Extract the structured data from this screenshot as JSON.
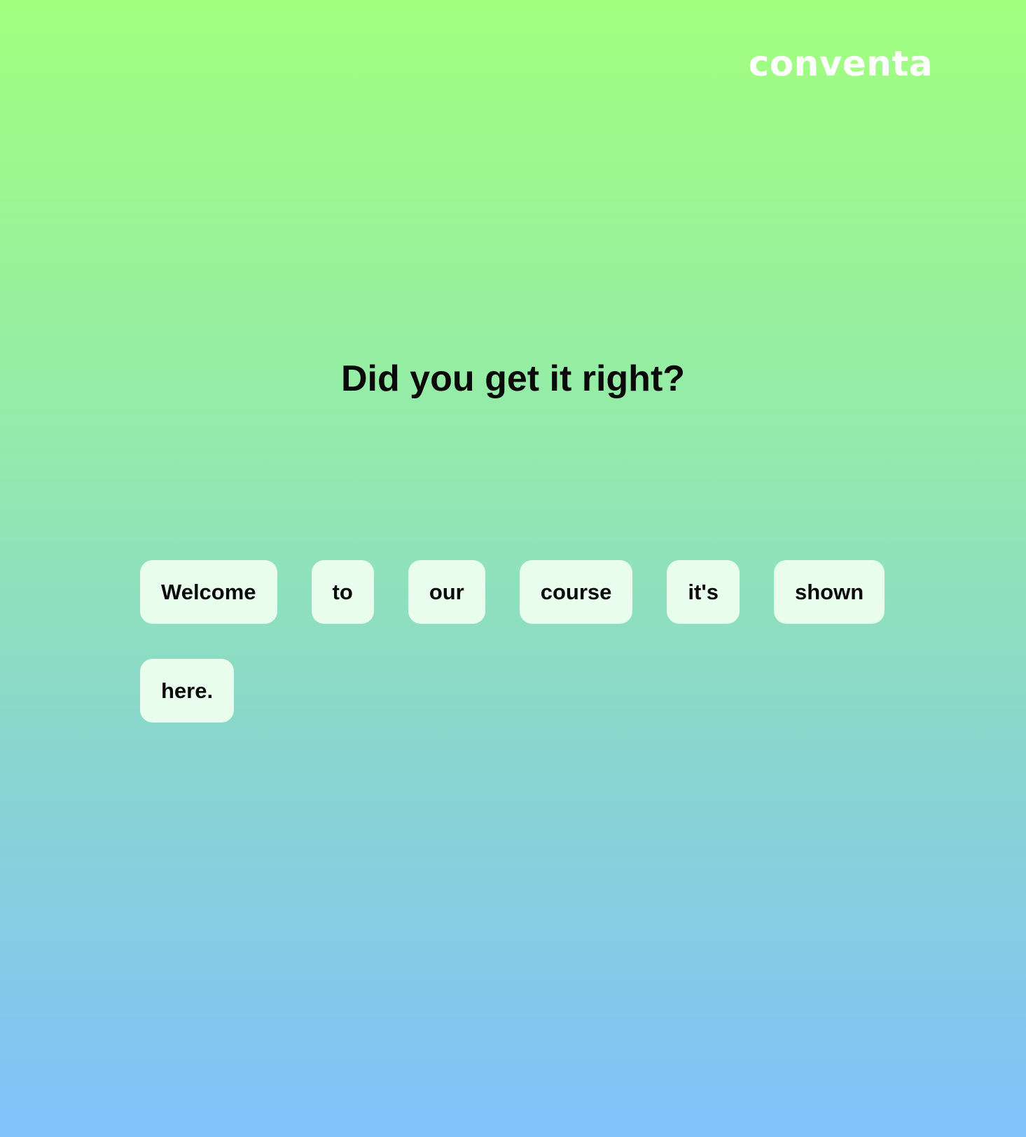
{
  "brand": {
    "logo_text": "conventa"
  },
  "main": {
    "question": "Did you get it right?",
    "words": [
      {
        "label": "Welcome"
      },
      {
        "label": "to"
      },
      {
        "label": "our"
      },
      {
        "label": "course"
      },
      {
        "label": "it's"
      },
      {
        "label": "shown"
      },
      {
        "label": "here."
      }
    ]
  },
  "colors": {
    "gradient_top": "#a2ff7e",
    "gradient_bottom": "#82c1fb",
    "chip_background": "#e8fdeb",
    "text": "#0a0a0a",
    "logo": "#ffffff"
  }
}
